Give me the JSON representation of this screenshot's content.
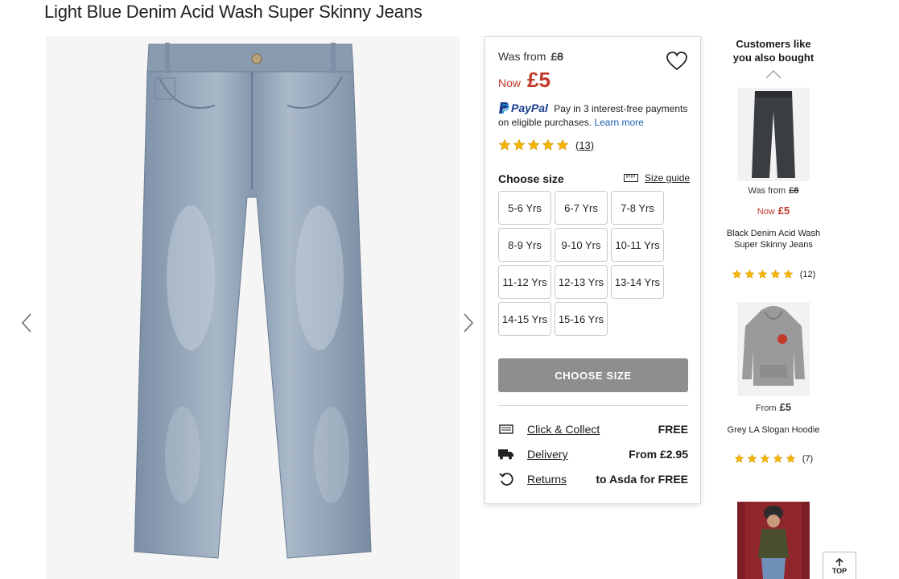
{
  "product": {
    "title": "Light Blue Denim Acid Wash Super Skinny Jeans"
  },
  "pricing": {
    "was_label": "Was from",
    "was_price": "£8",
    "now_label": "Now",
    "now_price": "£5"
  },
  "paypal": {
    "logo": "PayPal",
    "message": "Pay in 3 interest-free payments on eligible purchases.",
    "link": "Learn more"
  },
  "rating": {
    "stars": 5,
    "count": "(13)"
  },
  "sizes": {
    "heading": "Choose size",
    "guide_label": "Size guide",
    "options": [
      "5-6 Yrs",
      "6-7 Yrs",
      "7-8 Yrs",
      "8-9 Yrs",
      "9-10 Yrs",
      "10-11 Yrs",
      "11-12 Yrs",
      "12-13 Yrs",
      "13-14 Yrs",
      "14-15 Yrs",
      "15-16 Yrs"
    ]
  },
  "cta": {
    "label": "CHOOSE SIZE"
  },
  "services": [
    {
      "label": "Click & Collect",
      "value": "FREE",
      "icon": "store-icon"
    },
    {
      "label": "Delivery",
      "value": "From £2.95",
      "icon": "truck-icon"
    },
    {
      "label": "Returns",
      "value": "to Asda for FREE",
      "icon": "returns-icon"
    }
  ],
  "recommendations": {
    "heading": "Customers like you also bought",
    "items": [
      {
        "was_label": "Was from",
        "was_price": "£8",
        "now_label": "Now",
        "now_price": "£5",
        "name": "Black Denim Acid Wash Super Skinny Jeans",
        "rating": 5,
        "count": "(12)"
      },
      {
        "from_label": "From",
        "price": "£5",
        "name": "Grey LA Slogan Hoodie",
        "rating": 5,
        "count": "(7)"
      },
      {
        "name": ""
      }
    ]
  },
  "back_to_top": {
    "label": "TOP"
  },
  "colors": {
    "sale_red": "#c0392b",
    "star": "#f5b400",
    "cta_disabled": "#8e8e8e",
    "paypal_dark": "#1a3f8c",
    "paypal_light": "#1ba0e2",
    "denim_light": "#9fb0c2"
  }
}
